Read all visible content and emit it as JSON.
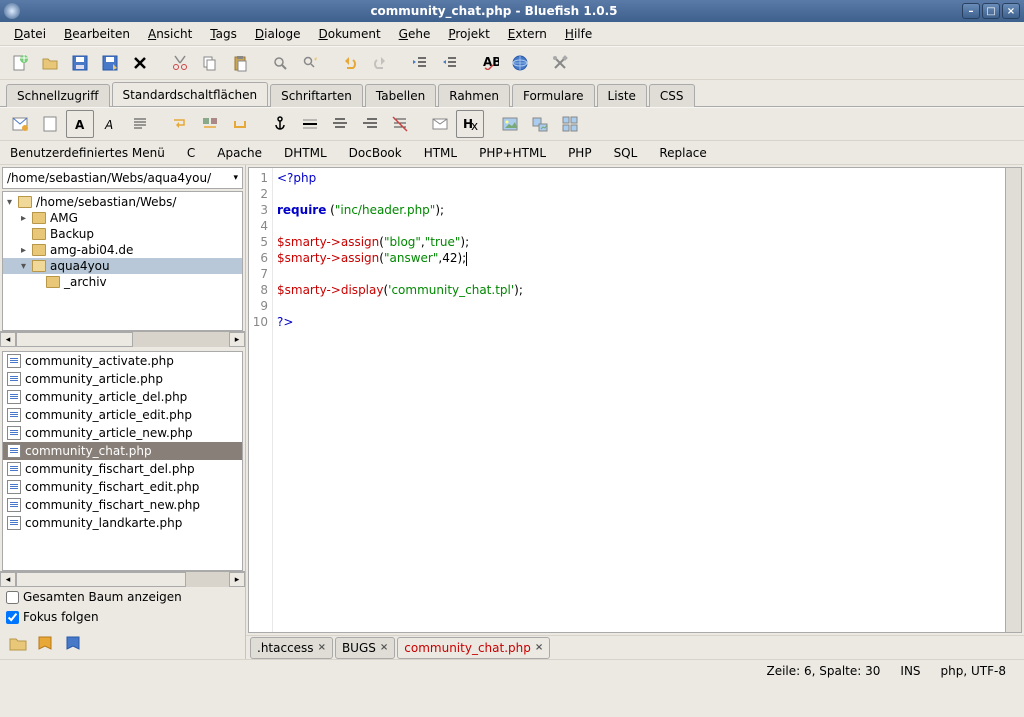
{
  "titlebar": {
    "text": "community_chat.php - Bluefish 1.0.5"
  },
  "menu": [
    "Datei",
    "Bearbeiten",
    "Ansicht",
    "Tags",
    "Dialoge",
    "Dokument",
    "Gehe",
    "Projekt",
    "Extern",
    "Hilfe"
  ],
  "toolbar_tabs": [
    "Schnellzugriff",
    "Standardschaltflächen",
    "Schriftarten",
    "Tabellen",
    "Rahmen",
    "Formulare",
    "Liste",
    "CSS"
  ],
  "toolbar_tabs_active": 1,
  "secmenu": [
    "Benutzerdefiniertes Menü",
    "C",
    "Apache",
    "DHTML",
    "DocBook",
    "HTML",
    "PHP+HTML",
    "PHP",
    "SQL",
    "Replace"
  ],
  "path": "/home/sebastian/Webs/aqua4you/",
  "tree": [
    {
      "level": 0,
      "exp": "▾",
      "label": "/home/sebastian/Webs/",
      "open": true
    },
    {
      "level": 1,
      "exp": "▸",
      "label": "AMG"
    },
    {
      "level": 1,
      "exp": "",
      "label": "Backup"
    },
    {
      "level": 1,
      "exp": "▸",
      "label": "amg-abi04.de"
    },
    {
      "level": 1,
      "exp": "▾",
      "label": "aqua4you",
      "sel": true,
      "open": true
    },
    {
      "level": 2,
      "exp": "",
      "label": "_archiv"
    }
  ],
  "files": [
    "community_activate.php",
    "community_article.php",
    "community_article_del.php",
    "community_article_edit.php",
    "community_article_new.php",
    "community_chat.php",
    "community_fischart_del.php",
    "community_fischart_edit.php",
    "community_fischart_new.php",
    "community_landkarte.php"
  ],
  "files_selected": 5,
  "sidechecks": {
    "baum": "Gesamten Baum anzeigen",
    "fokus": "Fokus folgen",
    "fokus_checked": true
  },
  "code_lines": [
    [
      [
        "c-tag",
        "<?php"
      ]
    ],
    [],
    [
      [
        "c-kw",
        "require"
      ],
      [
        "c-punc",
        " ("
      ],
      [
        "c-str",
        "\"inc/header.php\""
      ],
      [
        "c-punc",
        ");"
      ]
    ],
    [],
    [
      [
        "c-var",
        "$smarty"
      ],
      [
        "c-op",
        "->"
      ],
      [
        "c-fn",
        "assign"
      ],
      [
        "c-punc",
        "("
      ],
      [
        "c-str",
        "\"blog\""
      ],
      [
        "c-punc",
        ","
      ],
      [
        "c-str",
        "\"true\""
      ],
      [
        "c-punc",
        ");"
      ]
    ],
    [
      [
        "c-var",
        "$smarty"
      ],
      [
        "c-op",
        "->"
      ],
      [
        "c-fn",
        "assign"
      ],
      [
        "c-punc",
        "("
      ],
      [
        "c-str",
        "\"answer\""
      ],
      [
        "c-punc",
        ","
      ],
      [
        "c-num",
        "42"
      ],
      [
        "c-punc",
        ");"
      ],
      [
        "caret",
        ""
      ]
    ],
    [],
    [
      [
        "c-var",
        "$smarty"
      ],
      [
        "c-op",
        "->"
      ],
      [
        "c-fn",
        "display"
      ],
      [
        "c-punc",
        "("
      ],
      [
        "c-str",
        "'community_chat.tpl'"
      ],
      [
        "c-punc",
        ");"
      ]
    ],
    [],
    [
      [
        "c-tag",
        "?>"
      ]
    ]
  ],
  "editor_tabs": [
    {
      "label": ".htaccess",
      "active": false
    },
    {
      "label": "BUGS",
      "active": false
    },
    {
      "label": "community_chat.php",
      "active": true
    }
  ],
  "status": {
    "pos": "Zeile: 6, Spalte: 30",
    "ins": "INS",
    "mode": "php, UTF-8"
  }
}
